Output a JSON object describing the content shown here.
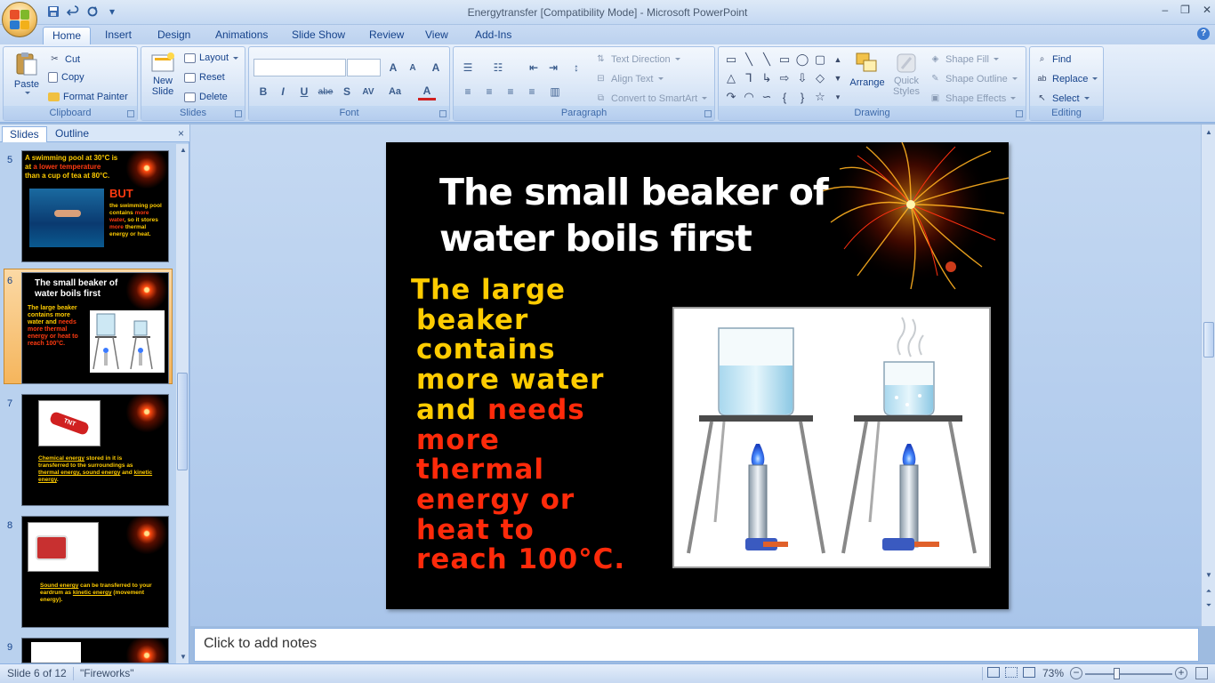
{
  "window": {
    "title": "Energytransfer [Compatibility Mode] - Microsoft PowerPoint",
    "minimize": "–",
    "restore": "❐",
    "close": "✕"
  },
  "qat": {
    "save_icon": "save-icon",
    "undo_icon": "undo-icon",
    "redo_icon": "redo-icon",
    "customize": "▾"
  },
  "tabs": [
    "Home",
    "Insert",
    "Design",
    "Animations",
    "Slide Show",
    "Review",
    "View",
    "Add-Ins"
  ],
  "active_tab": "Home",
  "ribbon": {
    "clipboard": {
      "label": "Clipboard",
      "paste": "Paste",
      "cut": "Cut",
      "copy": "Copy",
      "format_painter": "Format Painter"
    },
    "slides": {
      "label": "Slides",
      "new_slide_line1": "New",
      "new_slide_line2": "Slide",
      "layout": "Layout",
      "reset": "Reset",
      "delete": "Delete"
    },
    "font": {
      "label": "Font",
      "font_name": "",
      "font_size": "",
      "grow": "A",
      "shrink": "A",
      "clear": "A",
      "bold": "B",
      "italic": "I",
      "underline": "U",
      "strike": "abe",
      "shadow": "S",
      "spacing": "AV",
      "case": "Aa",
      "color": "A"
    },
    "paragraph": {
      "label": "Paragraph",
      "text_direction": "Text Direction",
      "align_text": "Align Text",
      "convert_smartart": "Convert to SmartArt"
    },
    "drawing": {
      "label": "Drawing",
      "arrange": "Arrange",
      "quick_styles_line1": "Quick",
      "quick_styles_line2": "Styles",
      "shape_fill": "Shape Fill",
      "shape_outline": "Shape Outline",
      "shape_effects": "Shape Effects"
    },
    "editing": {
      "label": "Editing",
      "find": "Find",
      "replace": "Replace",
      "select": "Select"
    }
  },
  "pane": {
    "tabs": [
      "Slides",
      "Outline"
    ],
    "close": "×",
    "thumbnails": [
      {
        "number": "5",
        "title_line1": "A swimming pool at 30°C is",
        "title_line2_a": "at ",
        "title_line2_b": "a lower temperature",
        "title_line3": "than a cup of tea at 80°C.",
        "but": "BUT",
        "body_a": "the swimming pool contains ",
        "body_b": "more water",
        "body_c": ", so it stores ",
        "body_d": "more",
        "body_e": " thermal energy or heat."
      },
      {
        "number": "6",
        "title_line1": "The small beaker of",
        "title_line2": "water boils first",
        "body_a": "The large beaker contains more water and ",
        "body_b": "needs more thermal energy or heat to reach 100°C."
      },
      {
        "number": "7",
        "image_text": "TNT",
        "body_a": "Chemical energy",
        "body_b": " stored in it is transferred to the surroundings as ",
        "body_c": "thermal energy, sound energy",
        "body_d": " and ",
        "body_e": "kinetic energy",
        "body_f": "."
      },
      {
        "number": "8",
        "body_a": "Sound energy",
        "body_b": " can be transferred to your eardrum as ",
        "body_c": "kinetic energy",
        "body_d": " (movement energy)."
      },
      {
        "number": "9"
      }
    ]
  },
  "slide": {
    "title_line1": "The small beaker of",
    "title_line2": "water boils first",
    "body_yellow_1": "The large",
    "body_yellow_2": "beaker",
    "body_yellow_3": "contains",
    "body_yellow_4": "more water",
    "body_yellow_5": "and ",
    "body_red_5": "needs",
    "body_red_6": "more",
    "body_red_7": "thermal",
    "body_red_8": "energy or",
    "body_red_9": "heat to",
    "body_red_10": "reach 100°C."
  },
  "notes": {
    "placeholder": "Click to add notes"
  },
  "status": {
    "slide_info": "Slide 6 of 12",
    "theme": "\"Fireworks\"",
    "zoom": "73%",
    "zoom_out": "−",
    "zoom_in": "+"
  },
  "colors": {
    "accent": "#15428b",
    "slide_bg": "#000000",
    "title": "#ffffff",
    "body_yellow": "#ffcc00",
    "body_red": "#ff2a0a"
  }
}
